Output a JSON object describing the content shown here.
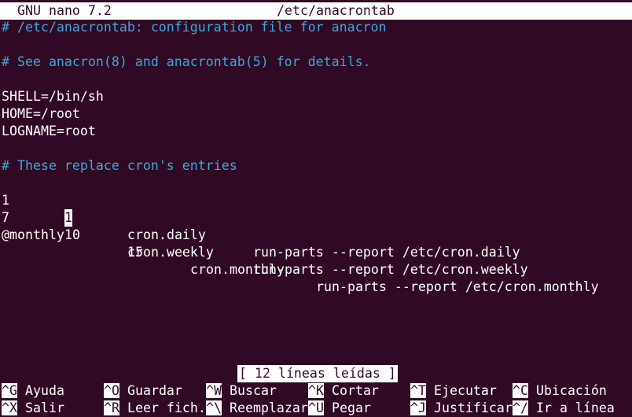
{
  "titlebar": {
    "app": "GNU nano 7.2",
    "file": "/etc/anacrontab"
  },
  "editor": {
    "lines": [
      "# /etc/anacrontab: configuration file for anacron",
      "",
      "# See anacron(8) and anacrontab(5) for details.",
      "",
      "SHELL=/bin/sh",
      "HOME=/root",
      "LOGNAME=root",
      "",
      "# These replace cron's entries",
      "1\t1\tcron.daily\trun-parts --report /etc/cron.daily",
      "7\t10\tcron.weekly\trun-parts --report /etc/cron.weekly",
      "@monthly\t15\tcron.monthly\trun-parts --report /etc/cron.monthly"
    ],
    "entry1_col1": "1",
    "entry1_cursor": "1",
    "entry1_job": "cron.daily",
    "entry1_cmd": "run-parts --report /etc/cron.daily",
    "entry2_col1": "7",
    "entry2_col2": "10",
    "entry2_job": "cron.weekly",
    "entry2_cmd": "run-parts --report /etc/cron.weekly",
    "entry3_col1": "@monthly",
    "entry3_col2": "15",
    "entry3_job": "cron.monthly",
    "entry3_cmd": "run-parts --report /etc/cron.monthly"
  },
  "status": "[ 12 líneas leídas ]",
  "shortcuts": [
    {
      "key": "^G",
      "label": "Ayuda"
    },
    {
      "key": "^O",
      "label": "Guardar"
    },
    {
      "key": "^W",
      "label": "Buscar"
    },
    {
      "key": "^K",
      "label": "Cortar"
    },
    {
      "key": "^T",
      "label": "Ejecutar"
    },
    {
      "key": "^C",
      "label": "Ubicación"
    },
    {
      "key": "^X",
      "label": "Salir"
    },
    {
      "key": "^R",
      "label": "Leer fich."
    },
    {
      "key": "^\\",
      "label": "Reemplazar"
    },
    {
      "key": "^U",
      "label": "Pegar"
    },
    {
      "key": "^J",
      "label": "Justificar"
    },
    {
      "key": "^/",
      "label": "Ir a línea"
    }
  ],
  "colors": {
    "background": "#300a24",
    "foreground": "#ffffff",
    "comment": "#3fa7d6"
  }
}
